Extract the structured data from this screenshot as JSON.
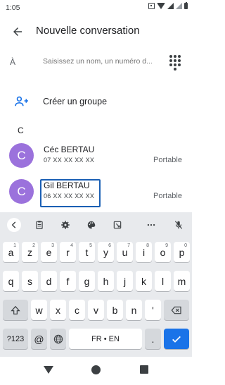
{
  "status": {
    "time": "1:05"
  },
  "appbar": {
    "title": "Nouvelle conversation"
  },
  "to": {
    "label": "À",
    "placeholder": "Saisissez un nom, un numéro d..."
  },
  "group": {
    "label": "Créer un groupe"
  },
  "section_letter": "C",
  "contacts": [
    {
      "initial": "C",
      "name": "Céc BERTAU",
      "number": "07 XX XX XX XX",
      "type": "Portable"
    },
    {
      "initial": "C",
      "name": "Gil BERTAU",
      "number": "06 XX XX XX XX",
      "type": "Portable"
    }
  ],
  "keyboard": {
    "row1": [
      {
        "k": "a",
        "n": "1"
      },
      {
        "k": "z",
        "n": "2"
      },
      {
        "k": "e",
        "n": "3"
      },
      {
        "k": "r",
        "n": "4"
      },
      {
        "k": "t",
        "n": "5"
      },
      {
        "k": "y",
        "n": "6"
      },
      {
        "k": "u",
        "n": "7"
      },
      {
        "k": "i",
        "n": "8"
      },
      {
        "k": "o",
        "n": "9"
      },
      {
        "k": "p",
        "n": "0"
      }
    ],
    "row2": [
      "q",
      "s",
      "d",
      "f",
      "g",
      "h",
      "j",
      "k",
      "l",
      "m"
    ],
    "row3": [
      "w",
      "x",
      "c",
      "v",
      "b",
      "n",
      "'"
    ],
    "sym": "?123",
    "at": "@",
    "space": "FR • EN",
    "period": "."
  },
  "colors": {
    "avatar": "#9b72dc",
    "accent": "#1a73e8",
    "highlight": "#1a5fb4"
  }
}
